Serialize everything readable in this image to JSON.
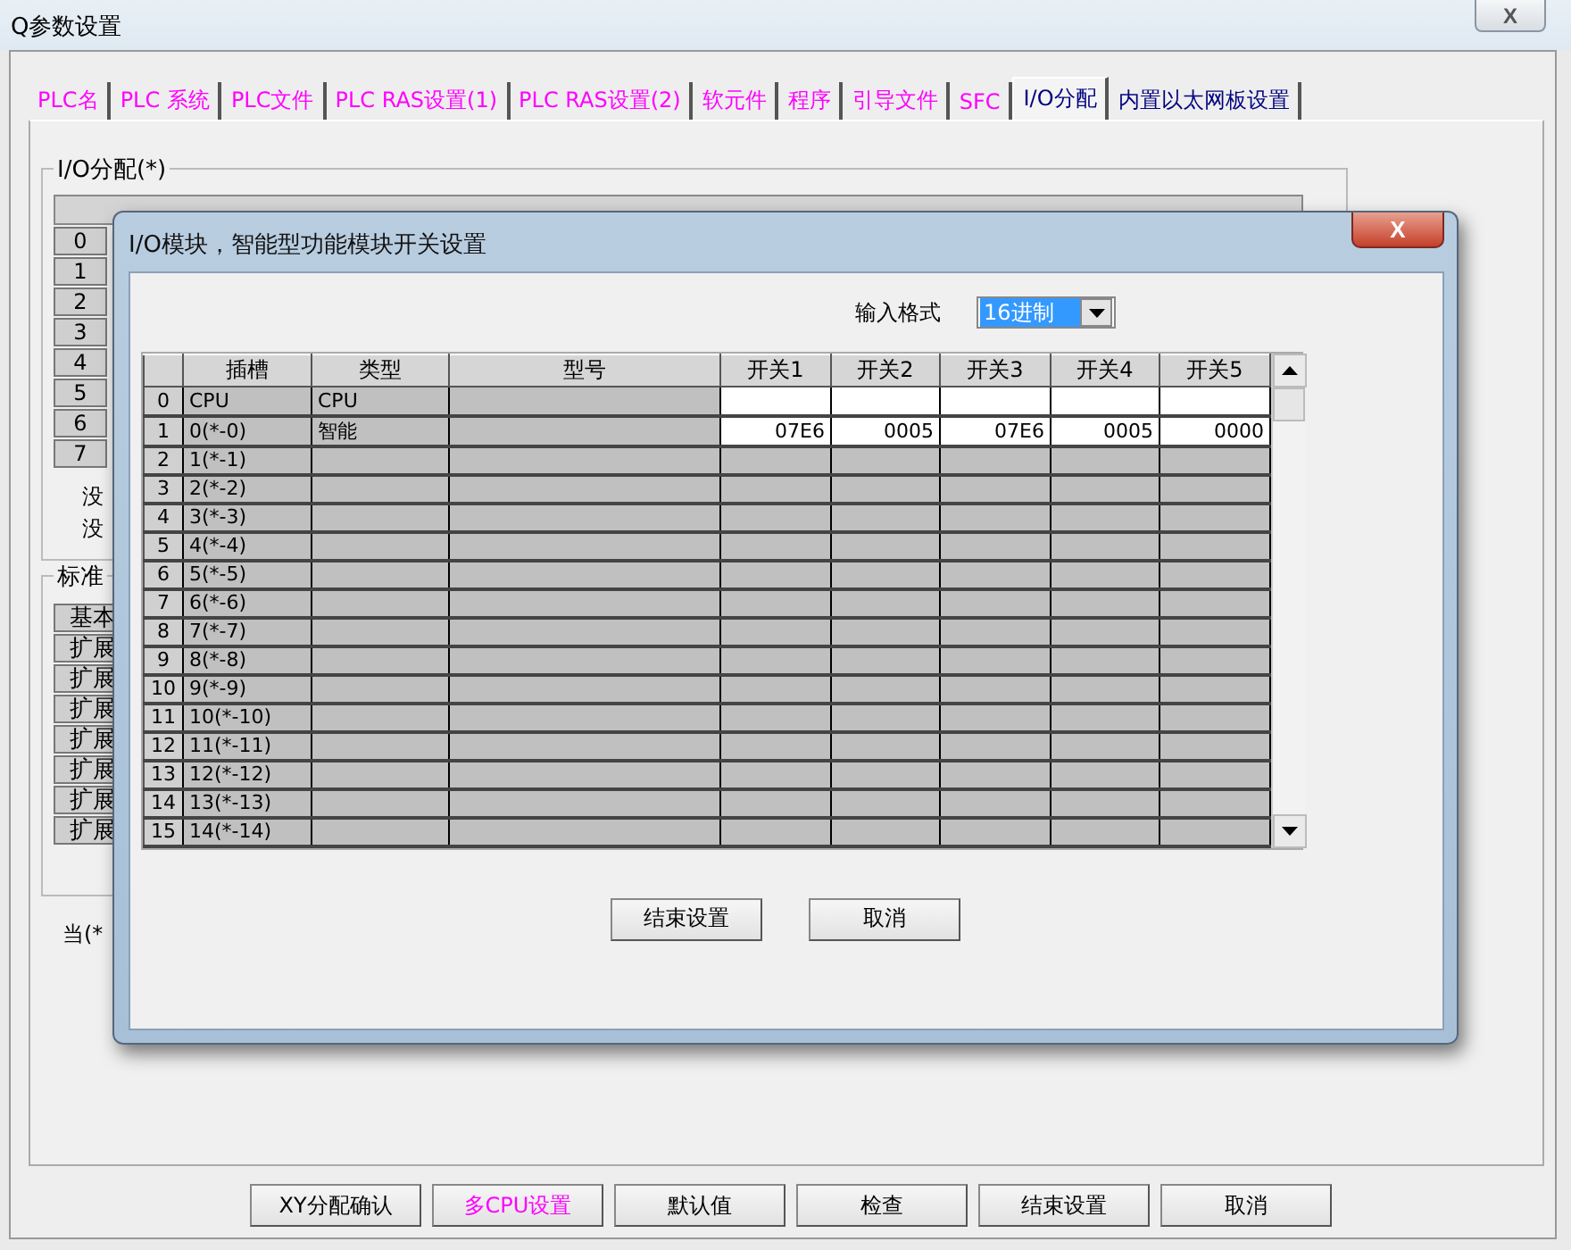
{
  "window": {
    "title": "Q参数设置",
    "close": "X"
  },
  "tabs": [
    {
      "label": "PLC名",
      "selected": false,
      "color": "#ff00ff"
    },
    {
      "label": "PLC 系统",
      "selected": false,
      "color": "#ff00ff"
    },
    {
      "label": "PLC文件",
      "selected": false,
      "color": "#ff00ff"
    },
    {
      "label": "PLC RAS设置(1)",
      "selected": false,
      "color": "#ff00ff"
    },
    {
      "label": "PLC RAS设置(2)",
      "selected": false,
      "color": "#ff00ff"
    },
    {
      "label": "软元件",
      "selected": false,
      "color": "#ff00ff"
    },
    {
      "label": "程序",
      "selected": false,
      "color": "#ff00ff"
    },
    {
      "label": "引导文件",
      "selected": false,
      "color": "#ff00ff"
    },
    {
      "label": "SFC",
      "selected": false,
      "color": "#ff00ff"
    },
    {
      "label": "I/O分配",
      "selected": true,
      "color": "#000080"
    },
    {
      "label": "内置以太网板设置",
      "selected": false,
      "color": "#000080"
    }
  ],
  "io_group": {
    "title": "I/O分配(*)",
    "row_numbers": [
      "0",
      "1",
      "2",
      "3",
      "4",
      "5",
      "6",
      "7"
    ],
    "notes": [
      "没",
      "没"
    ]
  },
  "standard_group": {
    "title": "标准",
    "rows": [
      "基本",
      "扩展",
      "扩展",
      "扩展",
      "扩展",
      "扩展",
      "扩展",
      "扩展"
    ]
  },
  "footnote": "当(*",
  "buttons": [
    {
      "label": "XY分配确认",
      "color": "#000000"
    },
    {
      "label": "多CPU设置",
      "color": "#ff00ff"
    },
    {
      "label": "默认值",
      "color": "#000000"
    },
    {
      "label": "检查",
      "color": "#000000"
    },
    {
      "label": "结束设置",
      "color": "#000000"
    },
    {
      "label": "取消",
      "color": "#000000"
    }
  ],
  "dialog": {
    "title": "I/O模块，智能型功能模块开关设置",
    "close": "X",
    "input_format": {
      "label": "输入格式",
      "value": "16进制",
      "highlighted": true
    },
    "table": {
      "columns": [
        "插槽",
        "类型",
        "型号",
        "开关1",
        "开关2",
        "开关3",
        "开关4",
        "开关5"
      ],
      "rows": [
        {
          "index": "0",
          "slot": "CPU",
          "type": "CPU",
          "editable": true
        },
        {
          "index": "1",
          "slot": "0(*-0)",
          "type": "智能",
          "editable": true,
          "switches": [
            "07E6",
            "0005",
            "07E6",
            "0005",
            "0000"
          ]
        },
        {
          "index": "2",
          "slot": "1(*-1)",
          "editable": false
        },
        {
          "index": "3",
          "slot": "2(*-2)",
          "editable": false
        },
        {
          "index": "4",
          "slot": "3(*-3)",
          "editable": false
        },
        {
          "index": "5",
          "slot": "4(*-4)",
          "editable": false
        },
        {
          "index": "6",
          "slot": "5(*-5)",
          "editable": false
        },
        {
          "index": "7",
          "slot": "6(*-6)",
          "editable": false
        },
        {
          "index": "8",
          "slot": "7(*-7)",
          "editable": false
        },
        {
          "index": "9",
          "slot": "8(*-8)",
          "editable": false
        },
        {
          "index": "10",
          "slot": "9(*-9)",
          "editable": false
        },
        {
          "index": "11",
          "slot": "10(*-10)",
          "editable": false
        },
        {
          "index": "12",
          "slot": "11(*-11)",
          "editable": false
        },
        {
          "index": "13",
          "slot": "12(*-12)",
          "editable": false
        },
        {
          "index": "14",
          "slot": "13(*-13)",
          "editable": false
        },
        {
          "index": "15",
          "slot": "14(*-14)",
          "editable": false
        }
      ]
    },
    "buttons": [
      "结束设置",
      "取消"
    ]
  }
}
